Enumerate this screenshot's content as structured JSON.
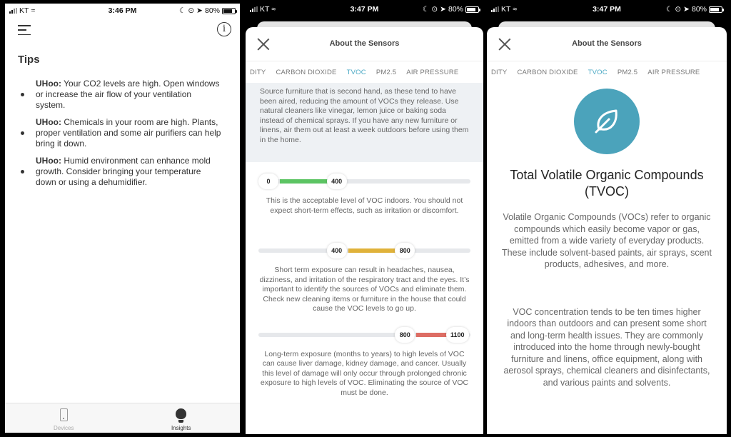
{
  "screens": [
    {
      "status": {
        "carrier": "KT",
        "time": "3:46 PM",
        "battery": "80%",
        "battery_level": 0.8
      },
      "header": {
        "menu_icon": "hamburger-icon",
        "info_icon": "info-icon",
        "info_glyph": "i"
      },
      "title": "Tips",
      "tips": [
        {
          "prefix": "UHoo:",
          "text": " Your CO2 levels are high. Open windows or increase the air flow of your ventilation system."
        },
        {
          "prefix": "UHoo:",
          "text": " Chemicals in your room are high. Plants, proper ventilation and some air purifiers can help bring it down."
        },
        {
          "prefix": "UHoo:",
          "text": " Humid environment can enhance mold growth. Consider bringing your temperature down or using a dehumidifier."
        }
      ],
      "tabbar": [
        {
          "label": "Devices",
          "icon": "device-icon",
          "active": false
        },
        {
          "label": "Insights",
          "icon": "lightbulb-icon",
          "active": true
        }
      ]
    },
    {
      "status": {
        "carrier": "KT",
        "time": "3:47 PM",
        "battery": "80%",
        "battery_level": 0.8
      },
      "sheet_title": "About the Sensors",
      "tabs": [
        "DITY",
        "CARBON DIOXIDE",
        "TVOC",
        "PM2.5",
        "AIR PRESSURE"
      ],
      "active_tab": "TVOC",
      "advice": "Source furniture that is second hand, as these tend to have been aired, reducing the amount of VOCs they release. Use natural cleaners like vinegar, lemon juice or baking soda instead of chemical sprays. If you have any new furniture or linens, air them out at least a week outdoors before using them in the home.",
      "scale_max": 1100,
      "levels": [
        {
          "min": "0",
          "max": "400",
          "min_value": 0,
          "max_value": 400,
          "color": "#5cc463",
          "description": "This is the acceptable level of VOC indoors. You should not expect short-term effects, such as irritation or discomfort."
        },
        {
          "min": "400",
          "max": "800",
          "min_value": 400,
          "max_value": 800,
          "color": "#e0b23a",
          "description": "Short term exposure can result in headaches, nausea, dizziness, and irritation of the respiratory tract and the eyes. It’s important to identify the sources of VOCs and eliminate them. Check new cleaning items or furniture in the house that could cause the VOC levels to go up."
        },
        {
          "min": "800",
          "max": "1100",
          "min_value": 800,
          "max_value": 1100,
          "color": "#dd6d64",
          "description": "Long-term exposure (months to years) to high levels of VOC can cause liver damage, kidney damage, and cancer. Usually this level of damage will only occur through prolonged chronic exposure to high levels of VOC. Eliminating the source of VOC must be done."
        }
      ]
    },
    {
      "status": {
        "carrier": "KT",
        "time": "3:47 PM",
        "battery": "80%",
        "battery_level": 0.8
      },
      "sheet_title": "About the Sensors",
      "tabs": [
        "DITY",
        "CARBON DIOXIDE",
        "TVOC",
        "PM2.5",
        "AIR PRESSURE"
      ],
      "active_tab": "TVOC",
      "icon": "leaf-icon",
      "accent_color": "#4ba3bb",
      "title": "Total Volatile Organic Compounds (TVOC)",
      "paragraphs": [
        "Volatile Organic Compounds (VOCs) refer to organic compounds which easily become vapor or gas, emitted from a wide variety of everyday products. These include solvent-based paints, air sprays, scent products, adhesives, and more.",
        "VOC concentration tends to be ten times higher indoors than outdoors and can present some short and long-term health issues. They are commonly introduced into the home through newly-bought furniture and linens, office equipment, along with aerosol sprays, chemical cleaners and disinfectants, and various paints and solvents."
      ]
    }
  ]
}
